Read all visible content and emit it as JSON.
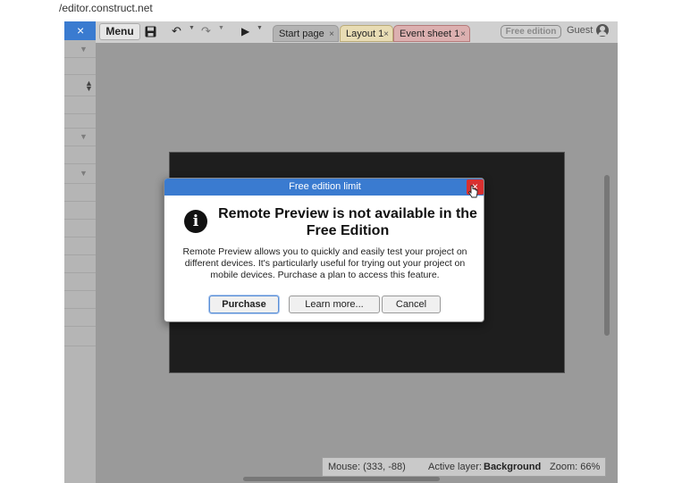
{
  "browser": {
    "url": "/editor.construct.net"
  },
  "toolbar": {
    "menu_label": "Menu",
    "tabs": [
      {
        "label": "Start page",
        "close": "×"
      },
      {
        "label": "Layout 1",
        "close": "×"
      },
      {
        "label": "Event sheet 1",
        "close": "×"
      }
    ],
    "edition_badge": "Free edition",
    "user": "Guest"
  },
  "left_panel": {
    "close": "×"
  },
  "dialog": {
    "title": "Free edition limit",
    "close": "×",
    "heading": "Remote Preview is not available in the Free Edition",
    "body": "Remote Preview allows you to quickly and easily test your project on different devices. It's particularly useful for trying out your project on mobile devices. Purchase a plan to access this feature.",
    "buttons": {
      "purchase": "Purchase",
      "learn_more": "Learn more...",
      "cancel": "Cancel"
    }
  },
  "status_bar": {
    "mouse": "Mouse: (333, -88)",
    "active_layer_label": "Active layer:",
    "active_layer_value": "Background",
    "zoom": "Zoom: 66%"
  },
  "colors": {
    "accent": "#3a7bd0",
    "close_red": "#d93030",
    "canvas": "#1e1e1e"
  }
}
